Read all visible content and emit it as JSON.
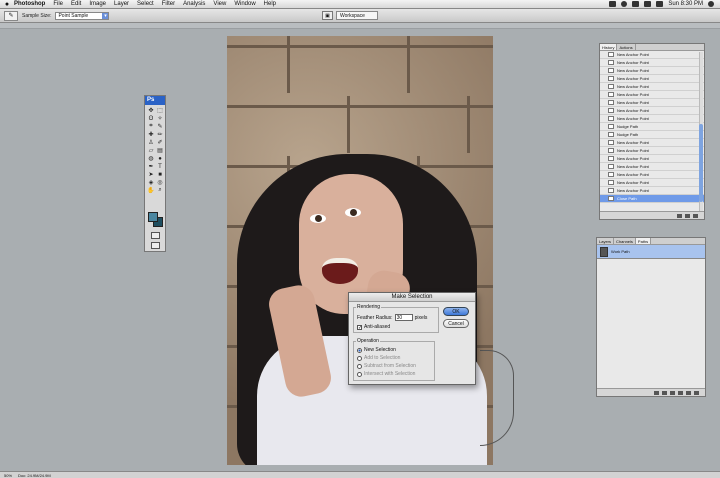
{
  "menubar": {
    "app_name": "Photoshop",
    "items": [
      "File",
      "Edit",
      "Image",
      "Layer",
      "Select",
      "Filter",
      "Analysis",
      "View",
      "Window",
      "Help"
    ],
    "clock": "Sun 8:30 PM"
  },
  "options_bar": {
    "sample_label": "Sample Size:",
    "sample_value": "Point Sample",
    "workspace_label": "Workspace"
  },
  "tools_panel": {
    "header": "Ps",
    "foreground_color": "#4a86a0",
    "background_color": "#1e4e60"
  },
  "dialog": {
    "title": "Make Selection",
    "rendering_label": "Rendering",
    "feather_label": "Feather Radius:",
    "feather_value": "30",
    "feather_unit": "pixels",
    "antialiased_label": "Anti-aliased",
    "antialiased_checked": true,
    "operation_label": "Operation",
    "operations": [
      {
        "label": "New Selection",
        "selected": true,
        "enabled": true
      },
      {
        "label": "Add to Selection",
        "selected": false,
        "enabled": false
      },
      {
        "label": "Subtract from Selection",
        "selected": false,
        "enabled": false
      },
      {
        "label": "Intersect with Selection",
        "selected": false,
        "enabled": false
      }
    ],
    "ok_label": "OK",
    "cancel_label": "Cancel"
  },
  "history_panel": {
    "tabs": [
      "History",
      "Actions"
    ],
    "items": [
      "New Anchor Point",
      "New Anchor Point",
      "New Anchor Point",
      "New Anchor Point",
      "New Anchor Point",
      "New Anchor Point",
      "New Anchor Point",
      "New Anchor Point",
      "New Anchor Point",
      "Nudge Path",
      "Nudge Path",
      "New Anchor Point",
      "New Anchor Point",
      "New Anchor Point",
      "New Anchor Point",
      "New Anchor Point",
      "New Anchor Point",
      "New Anchor Point",
      "Close Path"
    ],
    "selected_index": 18
  },
  "layers_panel": {
    "tabs": [
      "Layers",
      "Channels",
      "Paths"
    ],
    "active_tab": "Paths",
    "layer_name": "Work Path"
  },
  "statusbar": {
    "zoom": "50%",
    "doc_info": "Doc: 24.9M/24.9M"
  }
}
